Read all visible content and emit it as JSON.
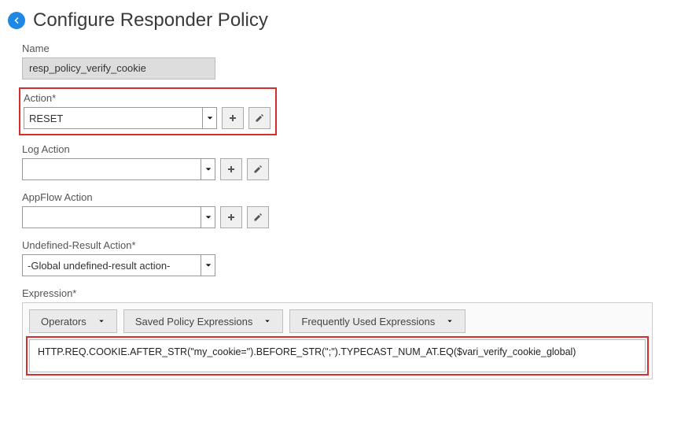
{
  "page": {
    "title": "Configure Responder Policy"
  },
  "fields": {
    "name": {
      "label": "Name",
      "value": "resp_policy_verify_cookie"
    },
    "action": {
      "label": "Action*",
      "value": "RESET"
    },
    "log_action": {
      "label": "Log Action",
      "value": ""
    },
    "appflow_action": {
      "label": "AppFlow Action",
      "value": ""
    },
    "undefined_result_action": {
      "label": "Undefined-Result Action*",
      "value": "-Global undefined-result action-"
    },
    "expression": {
      "label": "Expression*",
      "dropdowns": {
        "operators": "Operators",
        "saved": "Saved Policy Expressions",
        "frequent": "Frequently Used Expressions"
      },
      "value": "HTTP.REQ.COOKIE.AFTER_STR(\"my_cookie=\").BEFORE_STR(\";\").TYPECAST_NUM_AT.EQ($vari_verify_cookie_global)"
    }
  }
}
